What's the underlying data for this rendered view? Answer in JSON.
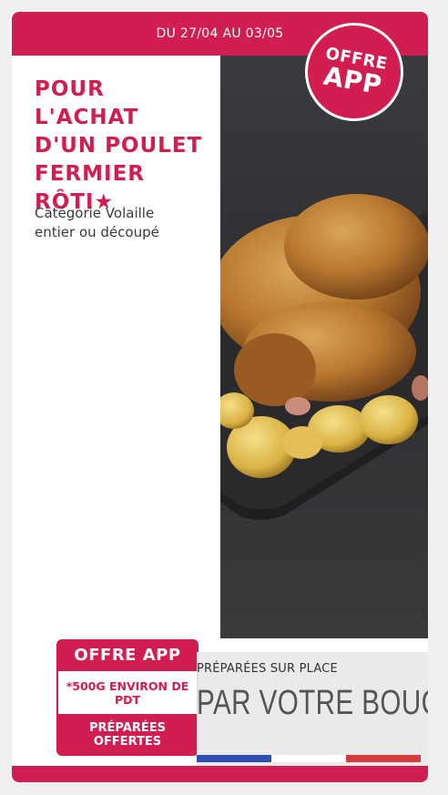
{
  "header": {
    "dates": "DU 27/04 AU 03/05"
  },
  "badge": {
    "line1": "OFFRE",
    "line2": "APP"
  },
  "title": {
    "lines": [
      "POUR L'ACHAT",
      "D'UN POULET",
      "FERMIER",
      "RÔTI★"
    ]
  },
  "subtitle": {
    "lines": [
      "Catégorie Volaille",
      "entier ou découpé"
    ]
  },
  "offer_box": {
    "title": "OFFRE APP",
    "note_line1": "*500G ENVIRON DE",
    "note_line2": "PDT",
    "bottom_line1": "PRÉPARÉES",
    "bottom_line2": "OFFERTES"
  },
  "boucher": {
    "small": "PRÉPARÉES SUR PLACE",
    "large": "PAR VOTRE BOUCHER"
  },
  "flag_colors": [
    "#2f4fb3",
    "#ffffff",
    "#d83a3a"
  ],
  "colors": {
    "brand": "#d11d4f",
    "photo_bg": "#333437"
  },
  "image": {
    "description_icon": "roast-chicken-photo"
  }
}
